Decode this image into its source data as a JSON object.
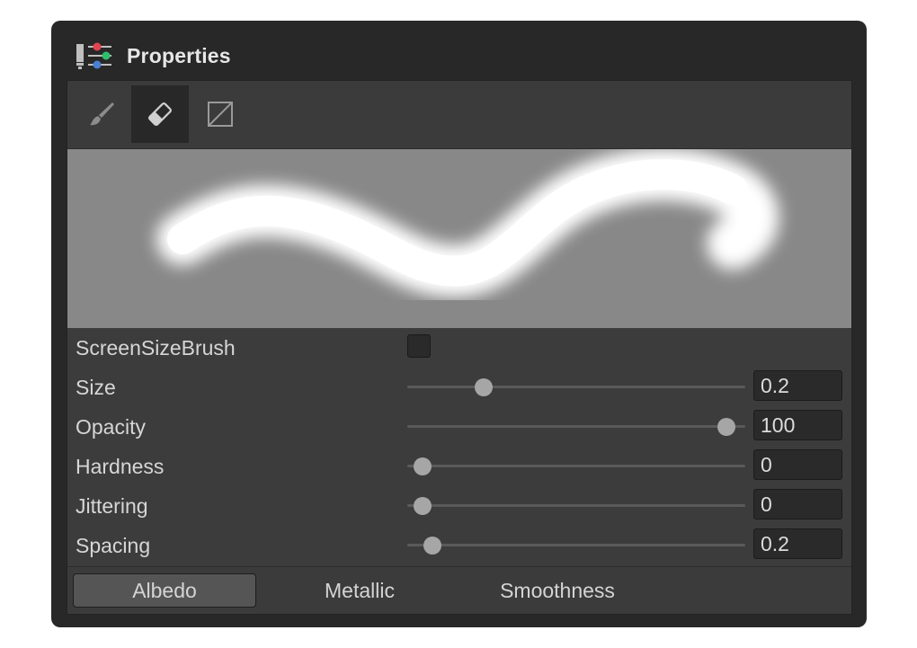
{
  "window": {
    "title": "Properties"
  },
  "toolbar": {
    "tools": [
      {
        "name": "brush",
        "icon": "brush-icon",
        "active": false
      },
      {
        "name": "eraser",
        "icon": "eraser-icon",
        "active": true
      },
      {
        "name": "fill",
        "icon": "fill-box-icon",
        "active": false
      }
    ]
  },
  "settings": {
    "screen_size_brush": {
      "label": "ScreenSizeBrush",
      "checked": false
    },
    "size": {
      "label": "Size",
      "value": "0.2",
      "fraction": 0.21
    },
    "opacity": {
      "label": "Opacity",
      "value": "100",
      "fraction": 0.97
    },
    "hardness": {
      "label": "Hardness",
      "value": "0",
      "fraction": 0.02
    },
    "jittering": {
      "label": "Jittering",
      "value": "0",
      "fraction": 0.02
    },
    "spacing": {
      "label": "Spacing",
      "value": "0.2",
      "fraction": 0.05
    }
  },
  "tabs": [
    {
      "label": "Albedo",
      "selected": true
    },
    {
      "label": "Metallic",
      "selected": false
    },
    {
      "label": "Smoothness",
      "selected": false
    }
  ],
  "colors": {
    "window_bg": "#282828",
    "panel_bg": "#3c3c3c",
    "preview_bg": "#888888",
    "red_accent": "#e0454f",
    "green_accent": "#2fbf6b",
    "blue_accent": "#4a7fd4"
  }
}
